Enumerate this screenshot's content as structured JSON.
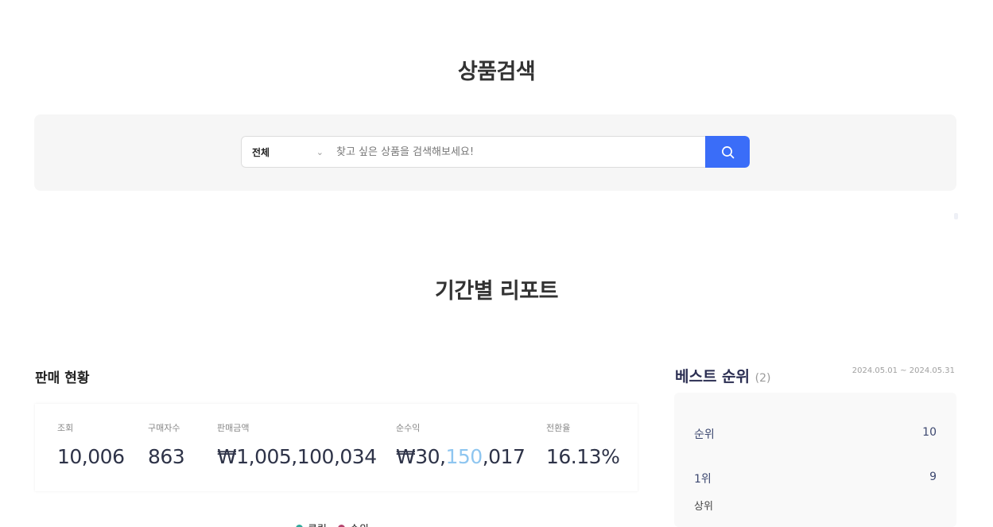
{
  "search_section": {
    "title": "상품검색",
    "category_selected": "전체",
    "placeholder": "찾고 싶은 상품을 검색해보세요!"
  },
  "report_section": {
    "title": "기간별 리포트",
    "left_heading": "판매 현황",
    "stats": [
      {
        "label": "조회",
        "value": "10,006"
      },
      {
        "label": "구매자수",
        "value": "863"
      },
      {
        "label": "판매금액",
        "value": "₩1,005,100,034"
      },
      {
        "label": "순수익",
        "value_prefix": "₩30,",
        "value_accent": "150",
        "value_suffix": ",017"
      },
      {
        "label": "전환율",
        "value": "16.13%"
      }
    ],
    "legend": [
      {
        "label": "클릭",
        "color": "#2fa89a"
      },
      {
        "label": "순위",
        "color": "#b4446e"
      }
    ],
    "right_heading": "베스트 순위",
    "right_heading_sub": "(2)",
    "right_date": "2024.05.01 ~ 2024.05.31",
    "rank_rows": [
      {
        "label": "순위",
        "value": "10"
      },
      {
        "label": "1위",
        "value": "9"
      }
    ],
    "rank_small": "상위"
  },
  "colors": {
    "primary_button": "#3a6df8",
    "panel_bg": "#f6f6f6"
  }
}
